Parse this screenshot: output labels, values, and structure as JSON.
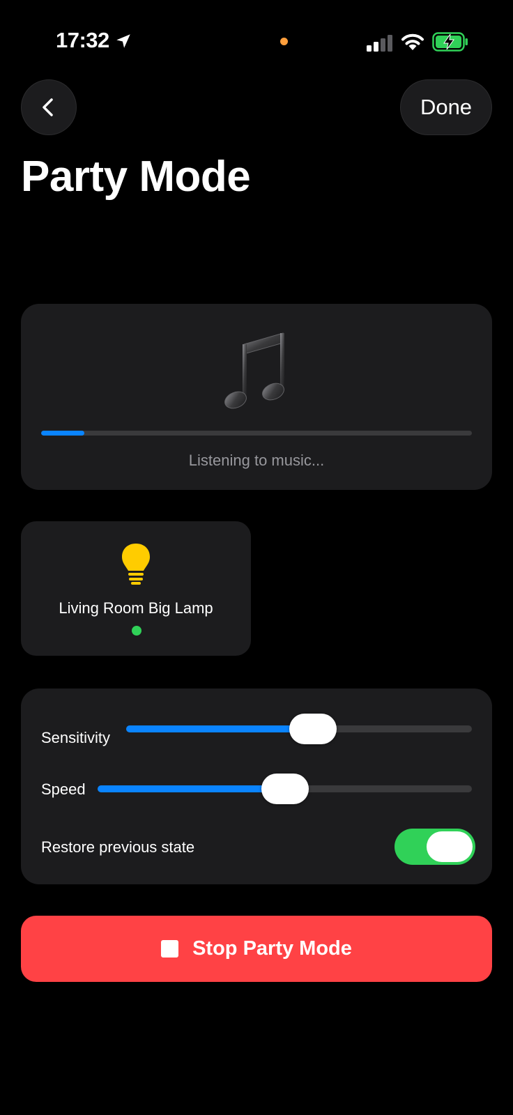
{
  "status_bar": {
    "time": "17:32",
    "icons": [
      "location-arrow-icon",
      "privacy-indicator",
      "cellular-signal-icon",
      "wifi-icon",
      "battery-charging-icon"
    ],
    "privacy_dot_color": "#ff9f3c",
    "battery_color": "#30d158"
  },
  "nav": {
    "back_icon": "chevron-left-icon",
    "done_label": "Done"
  },
  "page": {
    "title": "Party Mode"
  },
  "listening": {
    "icon": "music-note-icon",
    "progress_fraction": 0.1,
    "status_text": "Listening to music..."
  },
  "devices": [
    {
      "icon": "light-bulb-icon",
      "name": "Living Room Big Lamp",
      "status_color": "#30d158"
    }
  ],
  "settings": {
    "sensitivity": {
      "label": "Sensitivity",
      "value": 0.54
    },
    "speed": {
      "label": "Speed",
      "value": 0.5
    },
    "restore": {
      "label": "Restore previous state",
      "enabled": true
    }
  },
  "stop_button": {
    "icon": "stop-icon",
    "label": "Stop Party Mode",
    "color": "#ff4245"
  },
  "colors": {
    "accent": "#0a84ff",
    "card": "#1c1c1e",
    "toggle_on": "#30d158",
    "bulb": "#ffcc00"
  }
}
